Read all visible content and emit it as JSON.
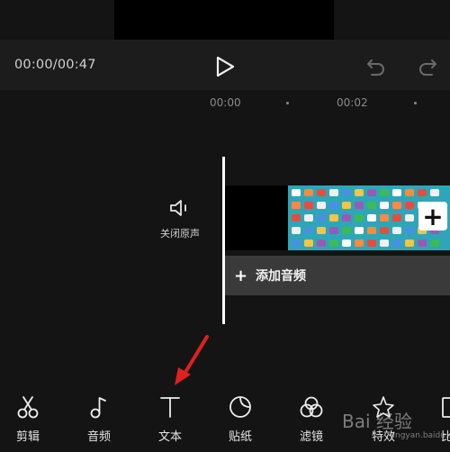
{
  "player": {
    "timecode": "00:00/00:47"
  },
  "timeline": {
    "ruler": [
      "00:00",
      "00:02"
    ],
    "mute_label": "关闭原声",
    "add_audio_label": "添加音频",
    "add_audio_plus": "+",
    "add_clip": "+"
  },
  "toolbar": {
    "items": [
      {
        "label": "剪辑",
        "icon": "scissors-icon"
      },
      {
        "label": "音频",
        "icon": "music-note-icon"
      },
      {
        "label": "文本",
        "icon": "text-icon"
      },
      {
        "label": "贴纸",
        "icon": "sticker-icon"
      },
      {
        "label": "滤镜",
        "icon": "filter-icon"
      },
      {
        "label": "特效",
        "icon": "effects-icon"
      },
      {
        "label": "比",
        "icon": "ratio-icon"
      }
    ]
  },
  "watermark": {
    "text": "Bai 经验",
    "sub": "jingyan.baidu.com"
  },
  "colors": {
    "background": "#141414",
    "control_bar": "#1c1c1c",
    "clip_thumbnail": "#2fa6b8",
    "add_audio_bar": "#3a3a3a",
    "annotation_arrow": "#e02020"
  }
}
